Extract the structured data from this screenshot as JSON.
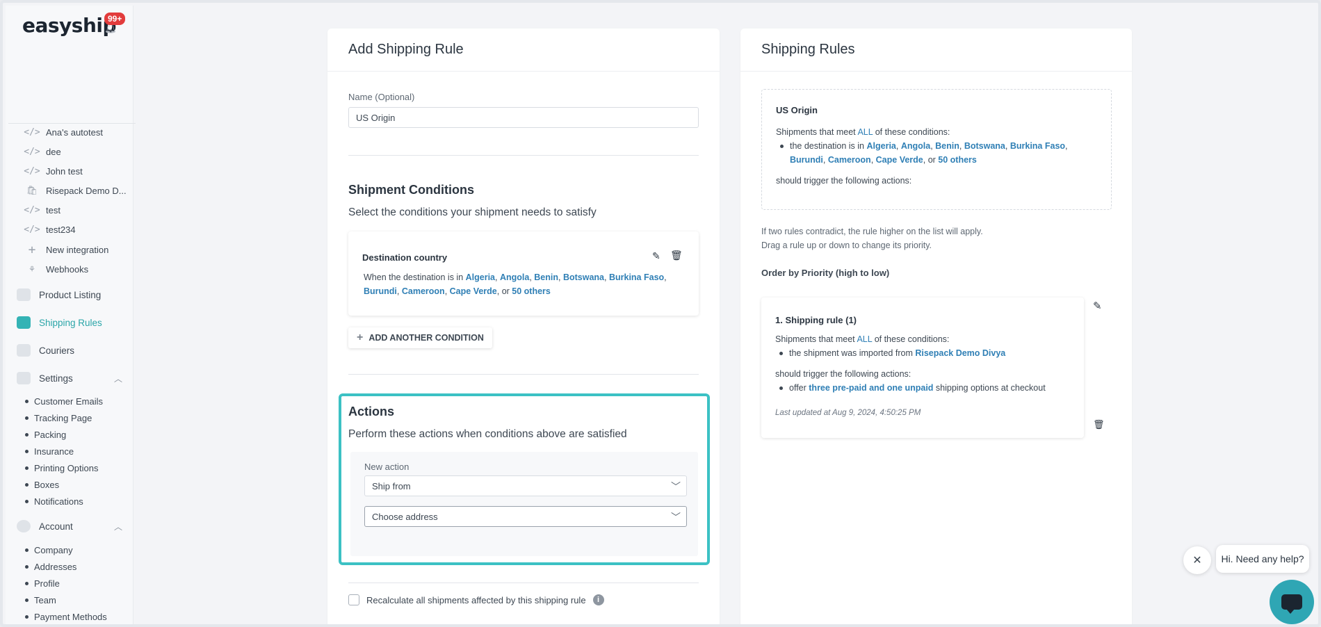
{
  "brand": {
    "logo": "easyship",
    "notifications": "99+"
  },
  "sidebar": {
    "integrations": [
      {
        "icon": "code-icon",
        "label": "Ana's autotest"
      },
      {
        "icon": "code-icon",
        "label": "dee"
      },
      {
        "icon": "code-icon",
        "label": "John test"
      },
      {
        "icon": "shopify-icon",
        "label": "Risepack Demo D..."
      },
      {
        "icon": "code-icon",
        "label": "test"
      },
      {
        "icon": "code-icon",
        "label": "test234"
      },
      {
        "icon": "plus-icon",
        "label": "New integration"
      },
      {
        "icon": "webhooks-icon",
        "label": "Webhooks"
      }
    ],
    "nav": {
      "product_listing": "Product Listing",
      "shipping_rules": "Shipping Rules",
      "couriers": "Couriers",
      "settings": "Settings",
      "account": "Account"
    },
    "settings_items": [
      "Customer Emails",
      "Tracking Page",
      "Packing",
      "Insurance",
      "Printing Options",
      "Boxes",
      "Notifications"
    ],
    "account_items": [
      "Company",
      "Addresses",
      "Profile",
      "Team",
      "Payment Methods"
    ]
  },
  "add_rule": {
    "title": "Add Shipping Rule",
    "name_label": "Name (Optional)",
    "name_value": "US Origin",
    "conditions_title": "Shipment Conditions",
    "conditions_subtitle": "Select the conditions your shipment needs to satisfy",
    "condition": {
      "title": "Destination country",
      "prefix": "When the destination is in ",
      "countries": [
        "Algeria",
        "Angola",
        "Benin",
        "Botswana",
        "Burkina Faso",
        "Burundi",
        "Cameroon",
        "Cape Verde"
      ],
      "or_text": ", or ",
      "others": "50 others"
    },
    "add_condition": "ADD ANOTHER CONDITION",
    "actions_title": "Actions",
    "actions_subtitle": "Perform these actions when conditions above are satisfied",
    "new_action_label": "New action",
    "action_select": "Ship from",
    "address_select": "Choose address",
    "recalc_label": "Recalculate all shipments affected by this shipping rule"
  },
  "rules_panel": {
    "title": "Shipping Rules",
    "preview": {
      "name": "US Origin",
      "meet_prefix": "Shipments that meet ",
      "all": "ALL",
      "meet_suffix": " of these conditions:",
      "bullet_prefix": "the destination is in ",
      "countries": [
        "Algeria",
        "Angola",
        "Benin",
        "Botswana",
        "Burkina Faso",
        "Burundi",
        "Cameroon",
        "Cape Verde"
      ],
      "or_text": ", or ",
      "others": "50 others",
      "trigger": "should trigger the following actions:"
    },
    "help_line1": "If two rules contradict, the rule higher on the list will apply.",
    "help_line2": "Drag a rule up or down to change its priority.",
    "order_title": "Order by Priority (high to low)",
    "rule": {
      "title": "1. Shipping rule (1)",
      "meet_prefix": "Shipments that meet ",
      "all": "ALL",
      "meet_suffix": " of these conditions:",
      "condition_prefix": "the shipment was imported from ",
      "condition_link": "Risepack Demo Divya",
      "trigger": "should trigger the following actions:",
      "action_prefix": "offer ",
      "action_link": "three pre-paid and one unpaid",
      "action_suffix": " shipping options at checkout",
      "updated": "Last updated at Aug 9, 2024, 4:50:25 PM"
    }
  },
  "chat": {
    "bubble": "Hi. Need any help?"
  }
}
